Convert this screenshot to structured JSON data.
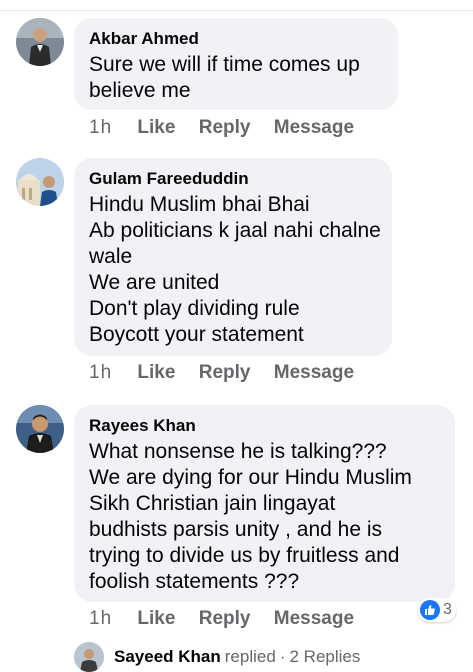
{
  "comments": [
    {
      "author": "Akbar Ahmed",
      "lines": [
        "Sure we will if time comes up",
        "believe me"
      ],
      "time": "1h",
      "like": "Like",
      "reply": "Reply",
      "message": "Message"
    },
    {
      "author": "Gulam Fareeduddin",
      "lines": [
        "Hindu Muslim bhai Bhai",
        "Ab politicians k jaal nahi chalne",
        "wale",
        "We are united",
        "Don't play dividing rule",
        "Boycott your statement"
      ],
      "time": "1h",
      "like": "Like",
      "reply": "Reply",
      "message": "Message"
    },
    {
      "author": "Rayees Khan",
      "lines": [
        "What nonsense he is talking???",
        "We are dying for our Hindu Muslim",
        "Sikh Christian jain lingayat",
        "budhists parsis unity , and he is",
        "trying to divide us by fruitless and",
        "foolish statements ???"
      ],
      "time": "1h",
      "like": "Like",
      "reply": "Reply",
      "message": "Message",
      "reaction_count": "3"
    }
  ],
  "replies_preview": {
    "name": "Sayeed Khan",
    "action": "replied",
    "separator": "·",
    "count": "2 Replies",
    "icon": "reply-arrow-icon"
  },
  "colors": {
    "bubble": "#f0f2f5",
    "meta_text": "#65676b",
    "like_blue": "#1877f2"
  }
}
